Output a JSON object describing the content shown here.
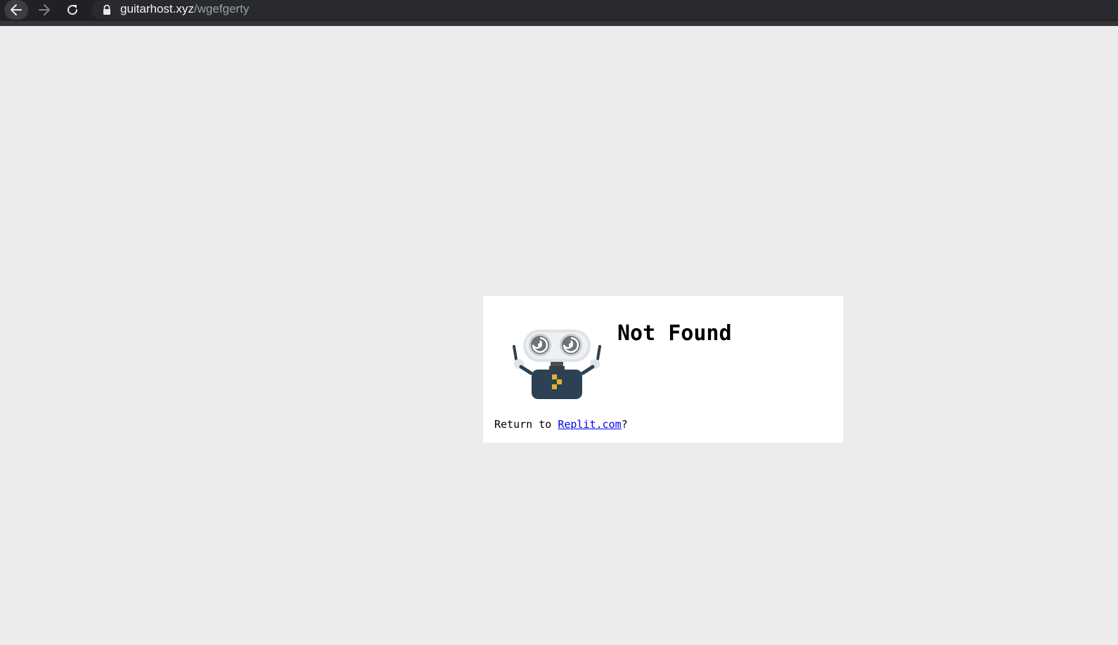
{
  "browser": {
    "url_host": "guitarhost.xyz",
    "url_path": "/wgefgerty",
    "back_icon": "arrow-left-icon",
    "forward_icon": "arrow-right-icon",
    "reload_icon": "reload-icon",
    "lock_icon": "lock-icon"
  },
  "page": {
    "title": "Not Found",
    "return_prefix": "Return to ",
    "return_link": "Replit.com",
    "return_suffix": "?",
    "illustration": "robot-icon"
  },
  "colors": {
    "background": "#ececec",
    "card": "#ffffff",
    "link": "#0000ee",
    "robot_body": "#2c4254",
    "robot_accent": "#e5b22b"
  }
}
